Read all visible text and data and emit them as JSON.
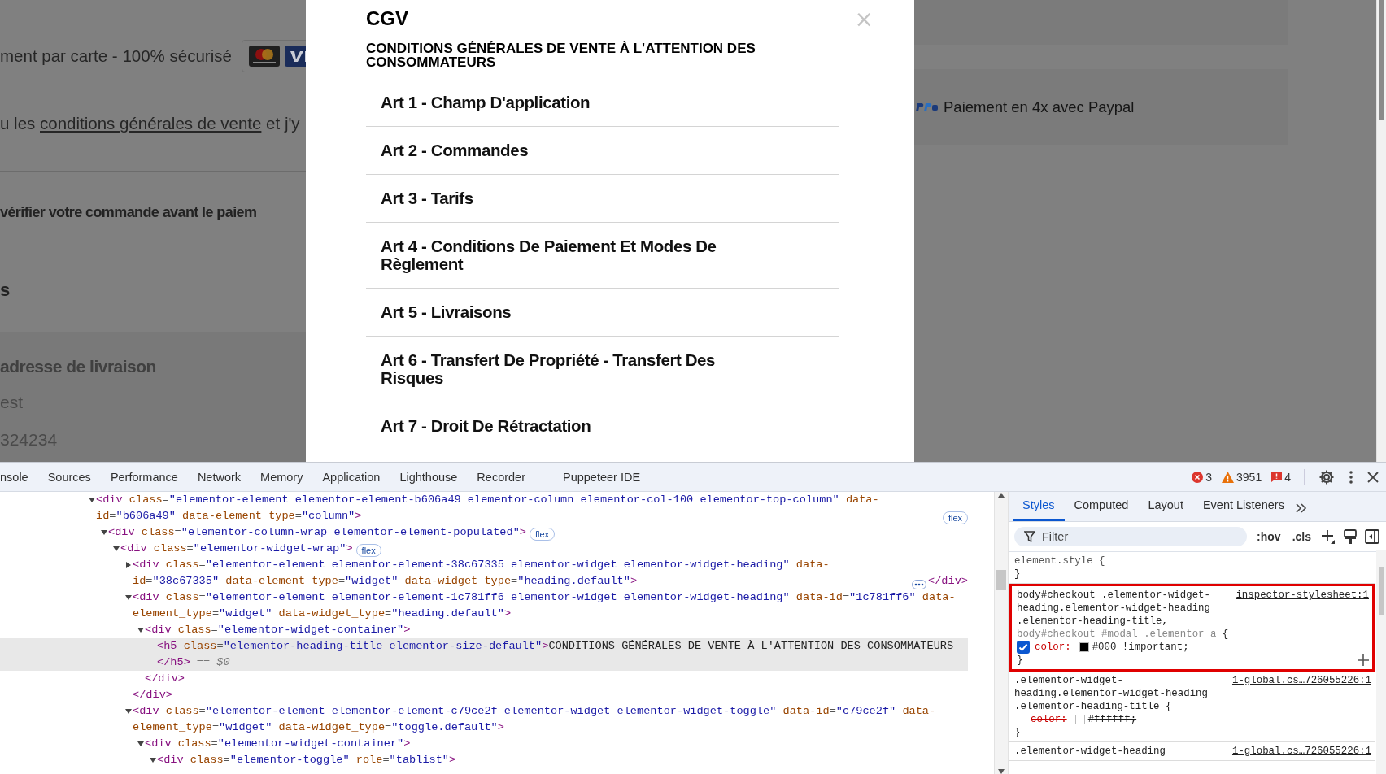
{
  "page": {
    "left": {
      "payment_note": "ment par carte - 100% sécurisé",
      "terms": {
        "before": "u les",
        "link": "conditions générales de vente",
        "after": "et j'y"
      },
      "review_heading": "vérifier votre commande avant le paiem",
      "section_tail": "s",
      "address_heading": "adresse de livraison",
      "address_line": "est",
      "address_number": "324234"
    },
    "right": {
      "paypal_note": "Paiement en 4x avec Paypal"
    }
  },
  "modal": {
    "title": "CGV",
    "close": "×",
    "subtitle": "CONDITIONS GÉNÉRALES DE VENTE À L'ATTENTION DES CONSOMMATEURS",
    "articles": [
      "Art 1 - Champ D'application",
      "Art 2 - Commandes",
      "Art 3 - Tarifs",
      "Art 4 - Conditions De Paiement Et Modes De Règlement",
      "Art 5 - Livraisons",
      "Art 6 - Transfert De Propriété - Transfert Des Risques",
      "Art 7 - Droit De Rétractation"
    ]
  },
  "devtools": {
    "tabs": [
      "nsole",
      "Sources",
      "Performance",
      "Network",
      "Memory",
      "Application",
      "Lighthouse",
      "Recorder",
      "Puppeteer IDE"
    ],
    "counters": {
      "errors": "3",
      "warnings": "3951",
      "issues": "4"
    },
    "dom": [
      {
        "kind": "element",
        "open": "<div class=\"elementor-element elementor-element-b606a49 elementor-column elementor-col-100 elementor-top-column\" data-id=\"b606a49\" data-element_type=\"column\">",
        "badge": "flex",
        "expanded": true,
        "selected": false,
        "children": [
          {
            "kind": "element",
            "open": "<div class=\"elementor-column-wrap elementor-element-populated\">",
            "badge": "flex",
            "expanded": true,
            "selected": false,
            "children": [
              {
                "kind": "element",
                "open": "<div class=\"elementor-widget-wrap\">",
                "badge": "flex",
                "expanded": true,
                "selected": false,
                "children": [
                  {
                    "kind": "element",
                    "open": "<div class=\"elementor-element elementor-element-38c67335 elementor-widget elementor-widget-heading\" data-id=\"38c67335\" data-element_type=\"widget\" data-widget_type=\"heading.default\">",
                    "inline_close": "</div>",
                    "expanded": false,
                    "selected": false
                  },
                  {
                    "kind": "element",
                    "open": "<div class=\"elementor-element elementor-element-1c781ff6 elementor-widget elementor-widget-heading\" data-id=\"1c781ff6\" data-element_type=\"widget\" data-widget_type=\"heading.default\">",
                    "expanded": true,
                    "selected": false,
                    "close": "</div>",
                    "children": [
                      {
                        "kind": "element",
                        "open": "<div class=\"elementor-widget-container\">",
                        "expanded": true,
                        "selected": false,
                        "close": "</div>",
                        "children": [
                          {
                            "kind": "text",
                            "open": "<h5 class=\"elementor-heading-title elementor-size-default\">CONDITIONS GÉNÉRALES DE VENTE À L'ATTENTION DES CONSOMMATEURS",
                            "close": "</h5>",
                            "marker": "== $0",
                            "selected": true
                          }
                        ]
                      }
                    ]
                  },
                  {
                    "kind": "element",
                    "open": "<div class=\"elementor-element elementor-element-c79ce2f elementor-widget elementor-widget-toggle\" data-id=\"c79ce2f\" data-element_type=\"widget\" data-widget_type=\"toggle.default\">",
                    "expanded": true,
                    "selected": false,
                    "children": [
                      {
                        "kind": "element",
                        "open": "<div class=\"elementor-widget-container\">",
                        "expanded": true,
                        "selected": false,
                        "children": [
                          {
                            "kind": "element",
                            "open": "<div class=\"elementor-toggle\" role=\"tablist\">",
                            "expanded": true,
                            "selected": false
                          }
                        ]
                      }
                    ]
                  }
                ]
              }
            ]
          }
        ]
      }
    ],
    "styles": {
      "tabs": [
        {
          "label": "Styles",
          "selected": true
        },
        {
          "label": "Computed",
          "selected": false
        },
        {
          "label": "Layout",
          "selected": false
        },
        {
          "label": "Event Listeners",
          "selected": false
        }
      ],
      "filter": {
        "placeholder": "Filter"
      },
      "toggles": [
        ":hov",
        ".cls"
      ],
      "rules": [
        {
          "selector": "element.style",
          "open": "{",
          "close": "}",
          "highlighted": false
        },
        {
          "selector": "body#checkout .elementor-widget-heading.elementor-widget-heading .elementor-heading-title,",
          "unmatched": "body#checkout #modal .elementor a",
          "open": "{",
          "source": "inspector-stylesheet:1",
          "close": "}",
          "highlighted": true,
          "declarations": [
            {
              "property": "color:",
              "value": "#000 !important;",
              "checked": true,
              "overridden": false
            }
          ]
        },
        {
          "selector": ".elementor-widget-heading.elementor-widget-heading .elementor-heading-title",
          "open": "{",
          "source": "1-global.cs…726055226:1",
          "close": "}",
          "highlighted": false,
          "declarations": [
            {
              "property": "color:",
              "value": "#ffffff;",
              "overridden": true
            }
          ]
        },
        {
          "selector": ".elementor-widget-heading",
          "source": "1-global.cs…726055226:1",
          "highlighted": false
        }
      ]
    }
  }
}
